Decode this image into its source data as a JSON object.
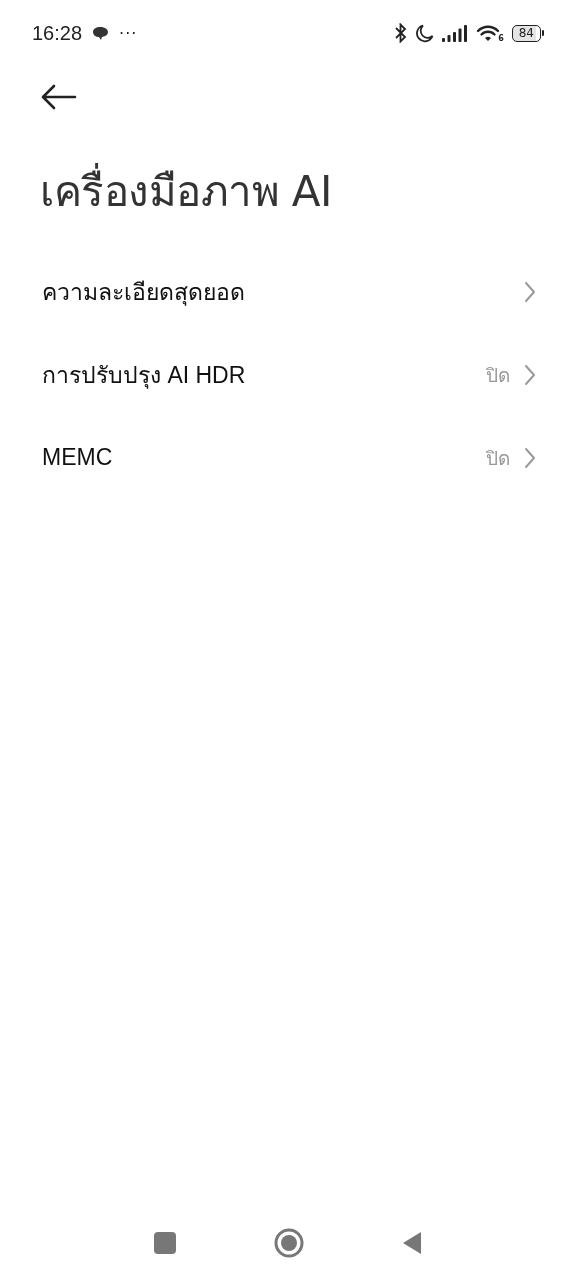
{
  "status_bar": {
    "time": "16:28",
    "more": "···",
    "wifi_label": "6",
    "battery": "84"
  },
  "title": "เครื่องมือภาพ AI",
  "items": [
    {
      "label": "ความละเอียดสุดยอด"
    },
    {
      "label": "การปรับปรุง AI HDR",
      "value": "ปิด"
    },
    {
      "label": "MEMC",
      "value": "ปิด"
    }
  ]
}
